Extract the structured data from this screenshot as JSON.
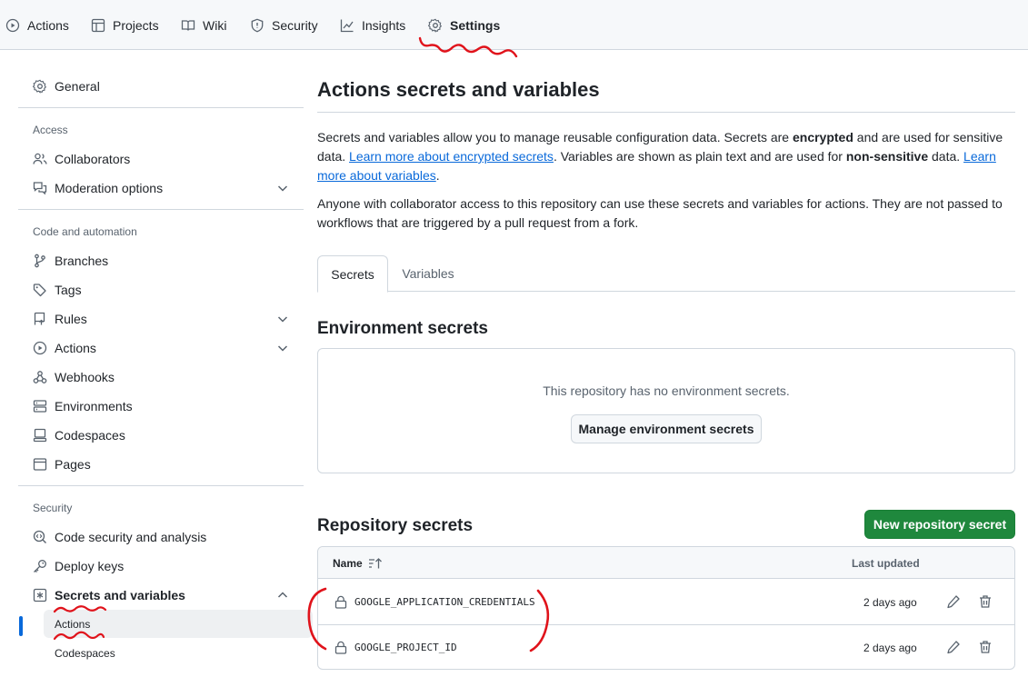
{
  "repo_nav": {
    "tabs": [
      {
        "label": "Actions",
        "icon": "play-icon"
      },
      {
        "label": "Projects",
        "icon": "table-icon"
      },
      {
        "label": "Wiki",
        "icon": "book-icon"
      },
      {
        "label": "Security",
        "icon": "shield-icon"
      },
      {
        "label": "Insights",
        "icon": "graph-icon"
      },
      {
        "label": "Settings",
        "icon": "gear-icon",
        "active": true
      }
    ]
  },
  "sidebar": {
    "general": "General",
    "access_heading": "Access",
    "access": [
      "Collaborators",
      "Moderation options"
    ],
    "code_heading": "Code and automation",
    "code": [
      "Branches",
      "Tags",
      "Rules",
      "Actions",
      "Webhooks",
      "Environments",
      "Codespaces",
      "Pages"
    ],
    "security_heading": "Security",
    "security": [
      "Code security and analysis",
      "Deploy keys",
      "Secrets and variables"
    ],
    "secrets_sub": [
      "Actions",
      "Codespaces"
    ]
  },
  "main": {
    "title": "Actions secrets and variables",
    "intro": {
      "p1_a": "Secrets and variables allow you to manage reusable configuration data. Secrets are ",
      "p1_b": "encrypted",
      "p1_c": " and are used for sensitive data. ",
      "p1_link1": "Learn more about encrypted secrets",
      "p1_d": ". Variables are shown as plain text and are used for ",
      "p1_e": "non-sensitive",
      "p1_f": " data. ",
      "p1_link2": "Learn more about variables",
      "p1_g": ".",
      "p2": "Anyone with collaborator access to this repository can use these secrets and variables for actions. They are not passed to workflows that are triggered by a pull request from a fork."
    },
    "tabs": [
      "Secrets",
      "Variables"
    ],
    "env": {
      "heading": "Environment secrets",
      "empty": "This repository has no environment secrets.",
      "button": "Manage environment secrets"
    },
    "repo": {
      "heading": "Repository secrets",
      "new_button": "New repository secret",
      "col_name": "Name",
      "col_updated": "Last updated",
      "secrets": [
        {
          "name": "GOOGLE_APPLICATION_CREDENTIALS",
          "updated": "2 days ago"
        },
        {
          "name": "GOOGLE_PROJECT_ID",
          "updated": "2 days ago"
        }
      ]
    }
  },
  "colors": {
    "accent": "#0969da",
    "primary_button": "#1f883d",
    "annotation": "#e0131b"
  }
}
